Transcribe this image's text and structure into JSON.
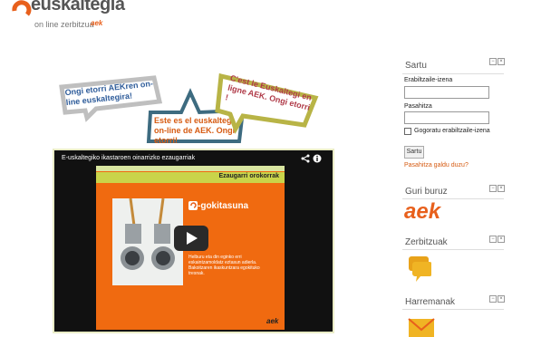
{
  "header": {
    "logo_text": "euskaltegia",
    "logo_tagline": "on line zerbitzua",
    "logo_brand": "aek"
  },
  "bubbles": [
    {
      "text": "Ongi etorri AEKren on-line euskaltegira!",
      "color": "#2e5c9a",
      "border": "#bfbfbf"
    },
    {
      "text": "Este es el euskaltegi on-line de AEK. Ongi etorri!",
      "color": "#d65b12",
      "border": "#3d6b80"
    },
    {
      "text": "C'est le Euskaltegi en ligne AEK. Ongi etorri !",
      "color": "#b03a48",
      "border": "#b8b446"
    }
  ],
  "video": {
    "title": "E-uskaltegiko ikastaroen oinarrizko ezaugarriak",
    "slide_header": "Ezaugarri orokorrak",
    "slide_brand": "-gokitasuna",
    "slide_body": "Helburu eta din eginko erri eskaintzamoldatz eztasun adierla. Bakoitzaren ikaskuntzara egokituko tresnak.",
    "slide_logo": "aek"
  },
  "sidebar": {
    "login": {
      "title": "Sartu",
      "username_label": "Erabiltzaile-izena",
      "password_label": "Pasahitza",
      "remember_label": "Gogoratu erabiltzaile-izena",
      "submit_label": "Sartu",
      "forgot_link": "Pasahitza galdu duzu?"
    },
    "about": {
      "title": "Guri buruz",
      "logo": "aek"
    },
    "services": {
      "title": "Zerbitzuak"
    },
    "contact": {
      "title": "Harremanak"
    }
  },
  "colors": {
    "accent": "#e8601c",
    "link": "#d65b12"
  },
  "icons": {
    "block_min": "−",
    "block_hide": "×"
  }
}
